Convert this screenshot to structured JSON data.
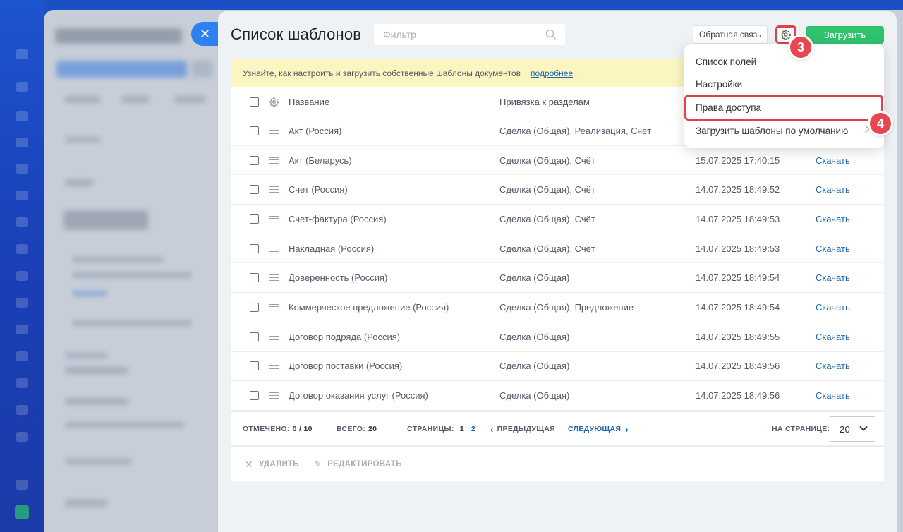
{
  "header": {
    "title": "Список шаблонов",
    "filter_placeholder": "Фильтр",
    "feedback_label": "Обратная связь",
    "upload_label": "Загрузить"
  },
  "badges": {
    "gear": "3",
    "access": "4"
  },
  "banner": {
    "text": "Узнайте, как настроить и загрузить собственные шаблоны документов",
    "link": "подробнее"
  },
  "table": {
    "headers": {
      "name": "Название",
      "binding": "Привязка к разделам"
    },
    "download_label": "Скачать",
    "rows": [
      {
        "name": "Акт (Россия)",
        "binding": "Сделка (Общая), Реализация, Счёт",
        "date": ""
      },
      {
        "name": "Акт (Беларусь)",
        "binding": "Сделка (Общая), Счёт",
        "date": "15.07.2025 17:40:15"
      },
      {
        "name": "Счет (Россия)",
        "binding": "Сделка (Общая), Счёт",
        "date": "14.07.2025 18:49:52"
      },
      {
        "name": "Счет-фактура (Россия)",
        "binding": "Сделка (Общая), Счёт",
        "date": "14.07.2025 18:49:53"
      },
      {
        "name": "Накладная (Россия)",
        "binding": "Сделка (Общая), Счёт",
        "date": "14.07.2025 18:49:53"
      },
      {
        "name": "Доверенность (Россия)",
        "binding": "Сделка (Общая)",
        "date": "14.07.2025 18:49:54"
      },
      {
        "name": "Коммерческое предложение (Россия)",
        "binding": "Сделка (Общая), Предложение",
        "date": "14.07.2025 18:49:54"
      },
      {
        "name": "Договор подряда (Россия)",
        "binding": "Сделка (Общая)",
        "date": "14.07.2025 18:49:55"
      },
      {
        "name": "Договор поставки (Россия)",
        "binding": "Сделка (Общая)",
        "date": "14.07.2025 18:49:56"
      },
      {
        "name": "Договор оказания услуг (Россия)",
        "binding": "Сделка (Общая)",
        "date": "14.07.2025 18:49:56"
      }
    ]
  },
  "footer": {
    "selected_label": "ОТМЕЧЕНО:",
    "selected_value": "0 / 10",
    "total_label": "ВСЕГО:",
    "total_value": "20",
    "pages_label": "СТРАНИЦЫ:",
    "page_1": "1",
    "page_2": "2",
    "prev_label": "ПРЕДЫДУЩАЯ",
    "next_label": "СЛЕДУЮЩАЯ",
    "per_page_label": "НА СТРАНИЦЕ:",
    "per_page_value": "20"
  },
  "actions": {
    "delete_label": "УДАЛИТЬ",
    "edit_label": "РЕДАКТИРОВАТЬ"
  },
  "menu": {
    "items": [
      "Список полей",
      "Настройки",
      "Права доступа",
      "Загрузить шаблоны по умолчанию"
    ]
  },
  "colors": {
    "accent_green": "#2fc26f",
    "highlight_red": "#e0414c",
    "link_blue": "#2067b0",
    "banner_yellow": "#fbf5c1"
  }
}
